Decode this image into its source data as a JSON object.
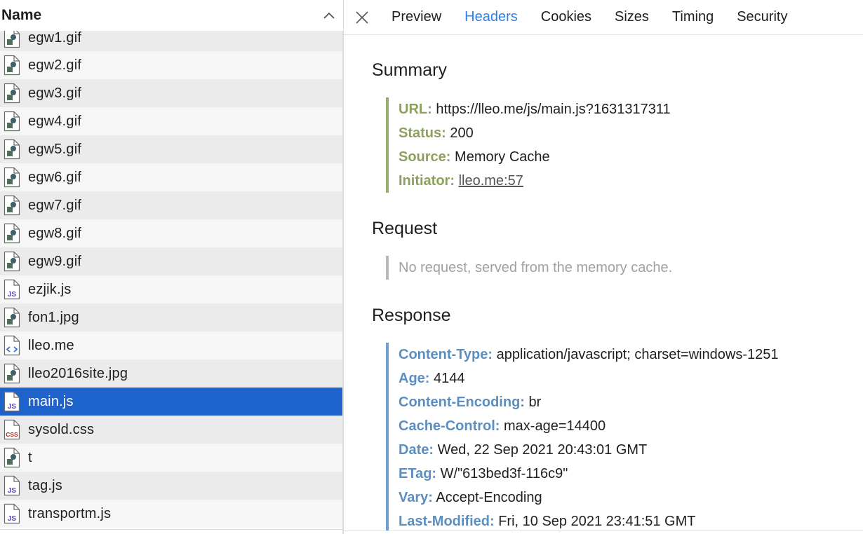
{
  "file_list": {
    "header": "Name",
    "rows": [
      {
        "name": "egw1.gif",
        "type": "image"
      },
      {
        "name": "egw2.gif",
        "type": "image"
      },
      {
        "name": "egw3.gif",
        "type": "image"
      },
      {
        "name": "egw4.gif",
        "type": "image"
      },
      {
        "name": "egw5.gif",
        "type": "image"
      },
      {
        "name": "egw6.gif",
        "type": "image"
      },
      {
        "name": "egw7.gif",
        "type": "image"
      },
      {
        "name": "egw8.gif",
        "type": "image"
      },
      {
        "name": "egw9.gif",
        "type": "image"
      },
      {
        "name": "ezjik.js",
        "type": "script"
      },
      {
        "name": "fon1.jpg",
        "type": "image"
      },
      {
        "name": "lleo.me",
        "type": "document"
      },
      {
        "name": "lleo2016site.jpg",
        "type": "image"
      },
      {
        "name": "main.js",
        "type": "script",
        "selected": true
      },
      {
        "name": "sysold.css",
        "type": "stylesheet"
      },
      {
        "name": "t",
        "type": "image"
      },
      {
        "name": "tag.js",
        "type": "script"
      },
      {
        "name": "transportm.js",
        "type": "script"
      }
    ]
  },
  "tabs": [
    "Preview",
    "Headers",
    "Cookies",
    "Sizes",
    "Timing",
    "Security"
  ],
  "active_tab": "Headers",
  "summary": {
    "title": "Summary",
    "url_label": "URL:",
    "url_value": "https://lleo.me/js/main.js?1631317311",
    "status_label": "Status:",
    "status_value": "200",
    "source_label": "Source:",
    "source_value": "Memory Cache",
    "initiator_label": "Initiator:",
    "initiator_value": "lleo.me:57"
  },
  "request": {
    "title": "Request",
    "message": "No request, served from the memory cache."
  },
  "response": {
    "title": "Response",
    "headers": [
      {
        "key": "Content-Type:",
        "value": "application/javascript; charset=windows-1251"
      },
      {
        "key": "Age:",
        "value": "4144"
      },
      {
        "key": "Content-Encoding:",
        "value": "br"
      },
      {
        "key": "Cache-Control:",
        "value": "max-age=14400"
      },
      {
        "key": "Date:",
        "value": "Wed, 22 Sep 2021 20:43:01 GMT"
      },
      {
        "key": "ETag:",
        "value": "W/\"613bed3f-116c9\""
      },
      {
        "key": "Vary:",
        "value": "Accept-Encoding"
      },
      {
        "key": "Last-Modified:",
        "value": "Fri, 10 Sep 2021 23:41:51 GMT"
      }
    ]
  },
  "icon_labels": {
    "script": "JS",
    "stylesheet": "CSS"
  },
  "colors": {
    "selection": "#1e63cc",
    "active_tab": "#2f80e6",
    "summary_key": "#8da15c",
    "response_key": "#5b8fc2",
    "image_icon": "#4f6f5a",
    "script_icon_text": "#5a3fb5",
    "css_icon_text": "#b0281f",
    "document_icon": "#2f6fd0"
  }
}
